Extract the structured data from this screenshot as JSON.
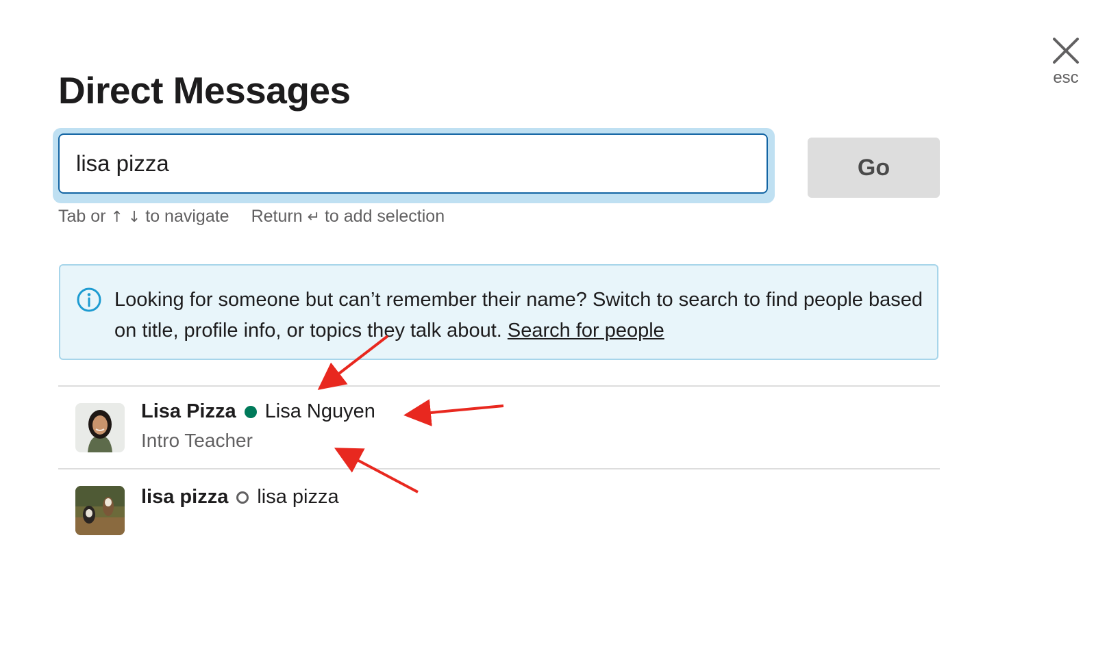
{
  "dialog": {
    "title": "Direct Messages",
    "close_label": "esc"
  },
  "search": {
    "value": "lisa pizza",
    "go_label": "Go"
  },
  "hints": {
    "navigate_prefix": "Tab or",
    "navigate_arrows": "↑ ↓",
    "navigate_suffix": "to navigate",
    "select_prefix": "Return",
    "select_arrow": "↵",
    "select_suffix": "to add selection"
  },
  "info": {
    "text": "Looking for someone but can’t remember their name? Switch to search to find people based on title, profile info, or topics they talk about.",
    "link": "Search for people"
  },
  "results": [
    {
      "display_name": "Lisa Pizza",
      "presence": "active",
      "real_name": "Lisa Nguyen",
      "title": "Intro Teacher"
    },
    {
      "display_name": "lisa pizza",
      "presence": "away",
      "real_name": "lisa pizza",
      "title": ""
    }
  ],
  "colors": {
    "focus_border": "#1264a3",
    "info_background": "#e8f5fa",
    "presence_active": "#007a5a",
    "annotation_arrow": "#e8281f"
  }
}
